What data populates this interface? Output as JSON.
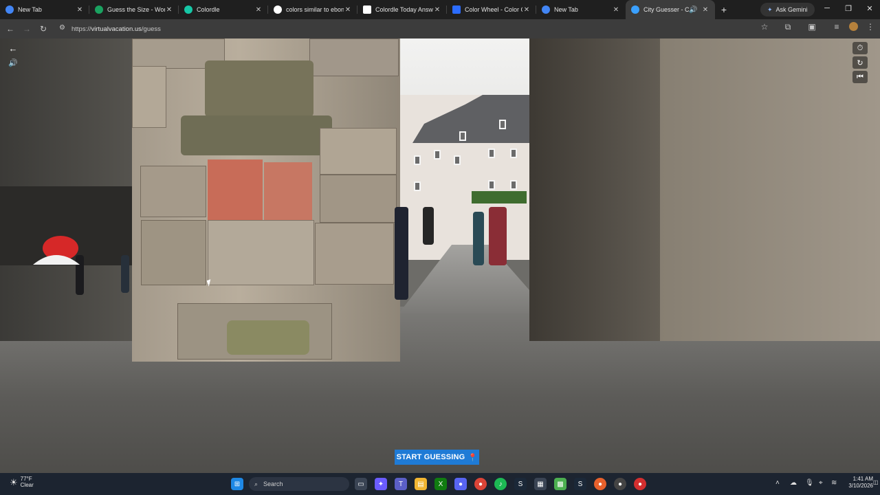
{
  "browser": {
    "tabs": [
      {
        "title": "New Tab",
        "favicon": "chrome-icon",
        "color": "#4285f4"
      },
      {
        "title": "Guess the Size - Worldl",
        "favicon": "worldle-icon",
        "color": "#1aa260"
      },
      {
        "title": "Colordle",
        "favicon": "colordle-icon",
        "color": "#16c7a6"
      },
      {
        "title": "colors similar to ebony",
        "favicon": "google-icon",
        "color": "#ffffff"
      },
      {
        "title": "Colordle Today Answer",
        "favicon": "page-icon",
        "color": "#ffffff"
      },
      {
        "title": "Color Wheel - Color Ca",
        "favicon": "canva-icon",
        "color": "#2b6cff"
      },
      {
        "title": "New Tab",
        "favicon": "chrome-icon",
        "color": "#4285f4"
      },
      {
        "title": "City Guesser - Can",
        "favicon": "globe-icon",
        "color": "#3aa0ff",
        "active": true
      }
    ],
    "new_tab_symbol": "+",
    "gemini_label": "Ask Gemini",
    "url_prefix": "https://",
    "url_host": "virtualvacation.us",
    "url_path": "/guess"
  },
  "game": {
    "start_button_label": "START GUESSING",
    "back_icon": "←",
    "volume_icon": "🔊"
  },
  "taskbar": {
    "weather_temp": "77°F",
    "weather_desc": "Clear",
    "search_label": "Search",
    "time": "1:41 AM",
    "date": "3/10/2026"
  }
}
